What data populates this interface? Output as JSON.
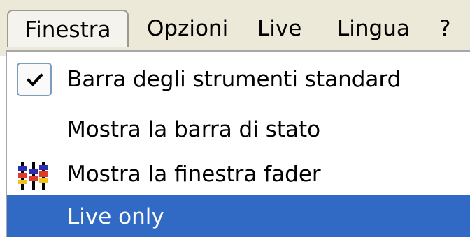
{
  "menubar": {
    "items": [
      {
        "label": "Finestra"
      },
      {
        "label": "Opzioni"
      },
      {
        "label": "Live"
      },
      {
        "label": "Lingua"
      },
      {
        "label": "?"
      }
    ],
    "active_index": 0
  },
  "dropdown": {
    "items": [
      {
        "label": "Barra degli strumenti standard",
        "checked": true,
        "icon": "check-icon"
      },
      {
        "label": "Mostra la barra di stato",
        "checked": false
      },
      {
        "label": "Mostra la finestra fader",
        "icon": "fader-icon"
      },
      {
        "label": "Live only",
        "highlighted": true
      }
    ]
  },
  "colors": {
    "highlight": "#316ac5",
    "menubar_bg": "#ece9d8"
  }
}
